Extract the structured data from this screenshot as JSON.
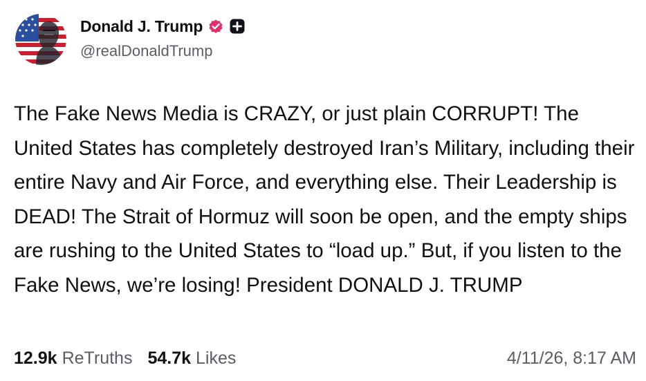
{
  "author": {
    "display_name": "Donald J. Trump",
    "handle": "@realDonaldTrump",
    "verified_icon": "verified-badge-icon",
    "plus_icon": "plus-badge-icon",
    "verified_color": "#e1306c"
  },
  "post": {
    "text": "The Fake News Media is CRAZY, or just plain CORRUPT! The United States has completely destroyed Iran’s Military, including their entire Navy and Air Force, and everything else. Their Leadership is DEAD! The Strait of Hormuz will soon be open, and the empty ships are rushing to the United States to “load up.” But, if you listen to the Fake News, we’re losing! President DONALD J. TRUMP",
    "timestamp": "4/11/26, 8:17 AM"
  },
  "stats": {
    "retruths_count": "12.9k",
    "retruths_label": "ReTruths",
    "likes_count": "54.7k",
    "likes_label": "Likes"
  }
}
